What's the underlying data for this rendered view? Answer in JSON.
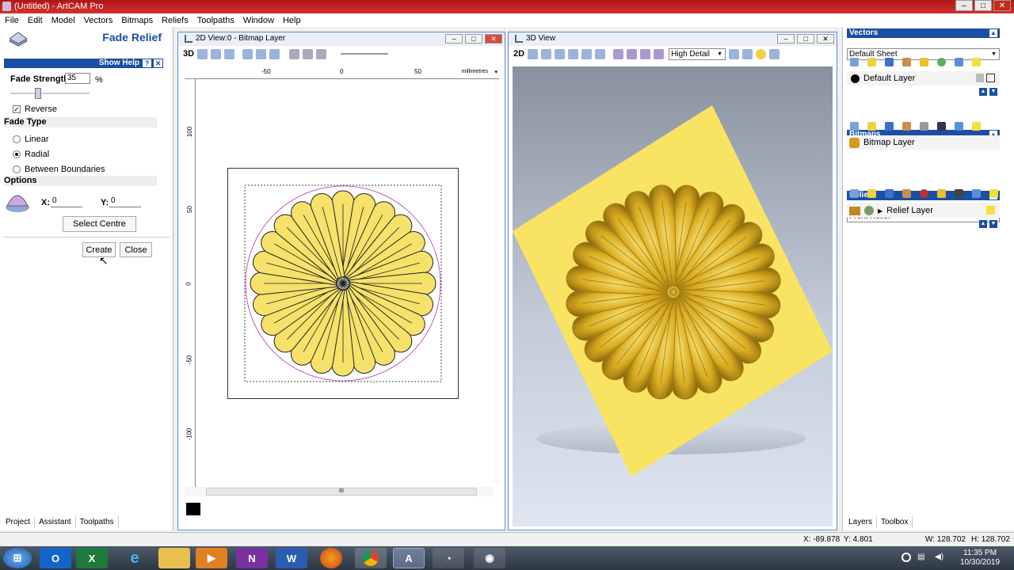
{
  "app": {
    "title": "(Untitled) - ArtCAM Pro"
  },
  "menu": [
    "File",
    "Edit",
    "Model",
    "Vectors",
    "Bitmaps",
    "Reliefs",
    "Toolpaths",
    "Window",
    "Help"
  ],
  "fade_relief": {
    "title": "Fade Relief",
    "show_help": "Show Help",
    "fade_strength_label": "Fade Strength:",
    "fade_strength_value": "35",
    "fade_strength_unit": "%",
    "fade_strength_fraction": 0.35,
    "reverse_label": "Reverse",
    "reverse_checked": true,
    "fade_type_header": "Fade Type",
    "fade_types": [
      {
        "label": "Linear",
        "selected": false
      },
      {
        "label": "Radial",
        "selected": true
      },
      {
        "label": "Between Boundaries",
        "selected": false
      }
    ],
    "options_header": "Options",
    "x_label": "X:",
    "x_value": "0",
    "y_label": "Y:",
    "y_value": "0",
    "select_centre": "Select Centre",
    "create": "Create",
    "close": "Close"
  },
  "left_tabs": [
    "Project",
    "Assistant",
    "Toolpaths"
  ],
  "view2d": {
    "title": "2D View:0 - Bitmap Layer",
    "mode": "3D",
    "ruler_unit": "millimetres",
    "h_ticks": [
      "-50",
      "0",
      "50"
    ],
    "v_ticks": [
      "100",
      "50",
      "0",
      "-50",
      "-100"
    ],
    "scroll_mid": "III"
  },
  "view3d": {
    "title": "3D View",
    "mode": "2D",
    "detail": "High Detail"
  },
  "right_panel": {
    "vectors": {
      "header": "Vectors",
      "sheet": "Default Sheet",
      "layer": "Default Layer"
    },
    "bitmaps": {
      "header": "Bitmaps",
      "layer": "Bitmap Layer"
    },
    "reliefs": {
      "header": "Reliefs",
      "relief": "Front Relief",
      "layer": "Relief Layer"
    },
    "tabs": [
      "Layers",
      "Toolbox"
    ]
  },
  "status": {
    "x": "X: -89.878",
    "y": "Y: 4.801",
    "w": "W: 128.702",
    "h": "H: 128.702"
  },
  "taskbar": {
    "time": "11:35 PM",
    "date": "10/30/2019",
    "apps": [
      "start",
      "outlook",
      "excel",
      "ie",
      "explorer",
      "media",
      "onenote",
      "word",
      "firefox",
      "chrome",
      "artcam",
      "app2",
      "app3"
    ]
  },
  "colors": {
    "panel_header": "#1a4fa3",
    "relief_yellow": "#f6e26a",
    "relief_gold": "#c9a020"
  }
}
